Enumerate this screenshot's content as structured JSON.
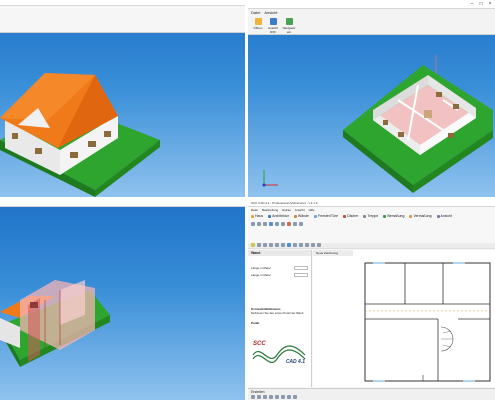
{
  "tr_ribbon": {
    "menu": [
      "Datei",
      "Ansicht"
    ],
    "buttons": [
      "Öffnen",
      "Ansicht DXF",
      "Navigator ein"
    ]
  },
  "br_app": {
    "title": "SCC CAD 4.1 - Professional (Vollversion) - v.4.1.9",
    "menu": [
      "Datei",
      "Bearbeitung",
      "Extras",
      "Ansicht",
      "Hilfe"
    ],
    "tabs": [
      {
        "label": "Haus",
        "color": "#e8a34a"
      },
      {
        "label": "Architektur",
        "color": "#3b78c4"
      },
      {
        "label": "Wände",
        "color": "#c98b3a"
      },
      {
        "label": "Fenster/Türe",
        "color": "#6aa6d8"
      },
      {
        "label": "Dächer",
        "color": "#c94c3a"
      },
      {
        "label": "Treppe",
        "color": "#7b8a99"
      },
      {
        "label": "Bemaßung",
        "color": "#3c9a4a"
      },
      {
        "label": "Vermaßung",
        "color": "#d0a040"
      },
      {
        "label": "Ansicht",
        "color": "#8a6fb8"
      }
    ],
    "left_header": "Wand",
    "left_fields": [
      "Länge in Meter",
      "Länge in Meter"
    ],
    "help_title": "Kontexthilfe/Hinweis",
    "help_text": "Definieren Sie den ersten Punkt der Wand",
    "help_text2": "Punkt",
    "logo_text": "SCC",
    "logo_sub": "CAD 4.1",
    "drawing_tab": "Neue Zeichnung",
    "status_label": "Erstellen"
  }
}
